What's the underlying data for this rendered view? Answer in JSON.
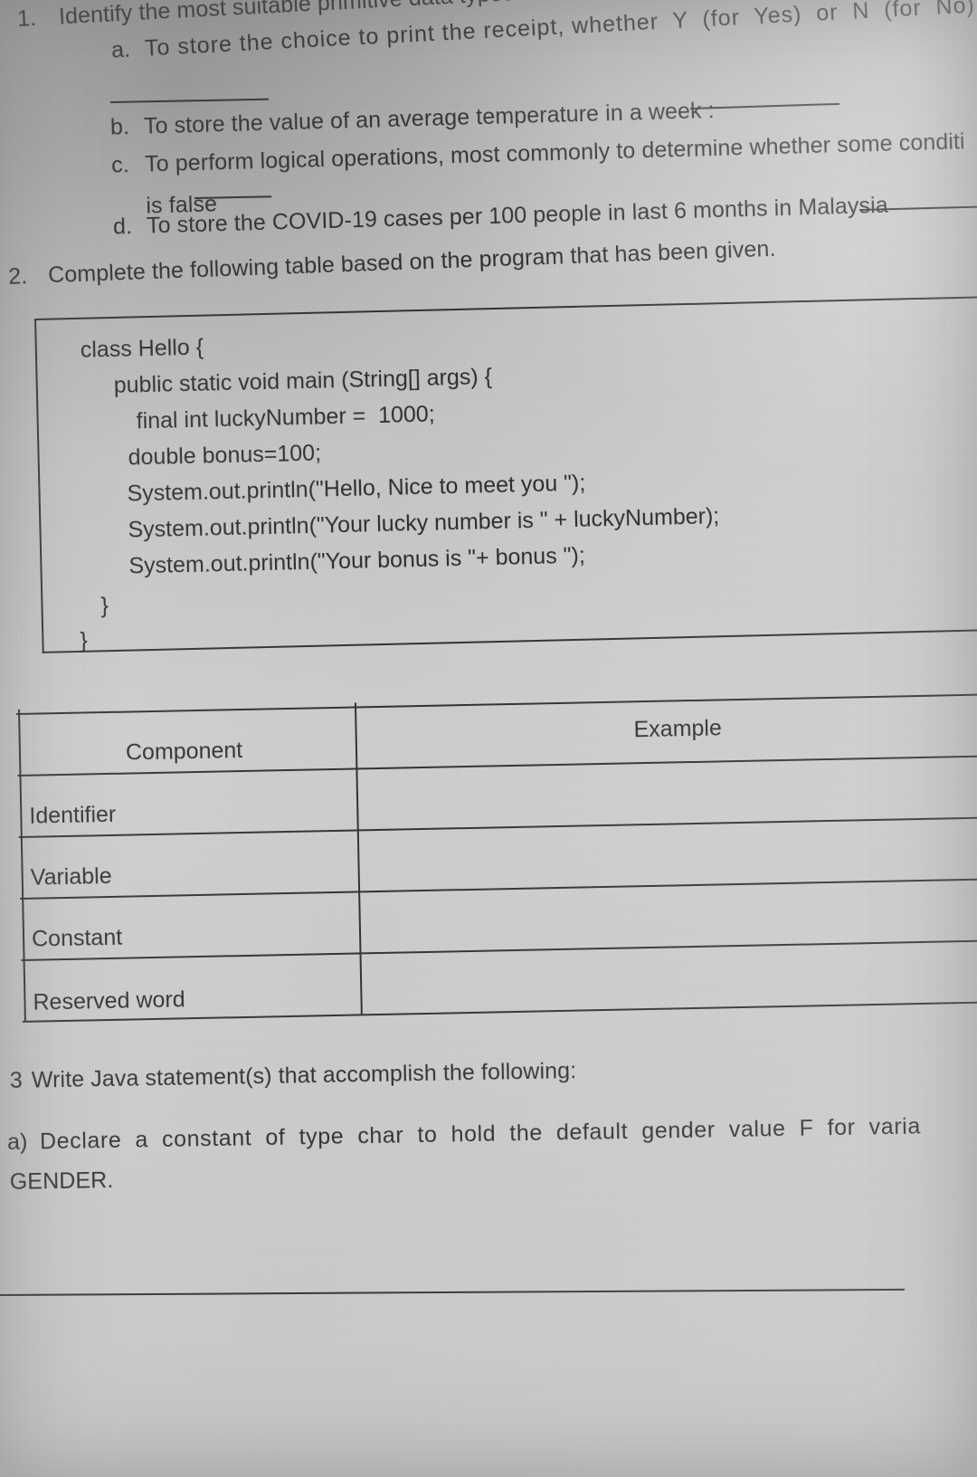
{
  "document": {
    "kind": "scanned-exam-worksheet-page",
    "page_background": "#c8c9c9",
    "ink_color": "#1a1a1a"
  },
  "question1": {
    "number": "1.",
    "stem": "Identify the most suitable primitive data types for the following situations:",
    "items": [
      {
        "label": "a.",
        "text": "To store the choice to print the receipt, whether  Y  (for  Yes)  or  N  (for  No)",
        "answer_blank": true
      },
      {
        "label": "b.",
        "text": "To store the value of an average temperature in a week :",
        "answer_blank": true
      },
      {
        "label": "c.",
        "text": "To perform logical operations, most commonly to determine whether some conditi",
        "text_continued": "is false",
        "answer_blank": true
      },
      {
        "label": "d.",
        "text": "To store the COVID-19 cases per 100 people in last 6 months in Malaysia",
        "answer_blank": true
      }
    ]
  },
  "question2": {
    "number": "2.",
    "stem": "Complete the following table based on the program that has been given.",
    "code": {
      "lines": [
        "class Hello {",
        "public static void main (String[] args) {",
        "final int luckyNumber =  1000;",
        "double bonus=100;",
        "System.out.println(\"Hello, Nice to meet you \");",
        "System.out.println(\"Your lucky number is \" + luckyNumber);",
        "System.out.println(\"Your bonus is \"+ bonus \");",
        "}",
        "}"
      ]
    },
    "table": {
      "headers": [
        "Component",
        "Example"
      ],
      "rows": [
        {
          "component": "Identifier",
          "example": ""
        },
        {
          "component": "Variable",
          "example": ""
        },
        {
          "component": "Constant",
          "example": ""
        },
        {
          "component": "Reserved word",
          "example": ""
        }
      ]
    }
  },
  "question3": {
    "number": "3",
    "stem": "Write Java statement(s) that accomplish the following:",
    "items": [
      {
        "label": "a)",
        "text": "Declare  a  constant  of  type  char  to  hold  the  default  gender  value  F  for  varia",
        "text_continued": "GENDER.",
        "answer_rule": true
      }
    ]
  }
}
